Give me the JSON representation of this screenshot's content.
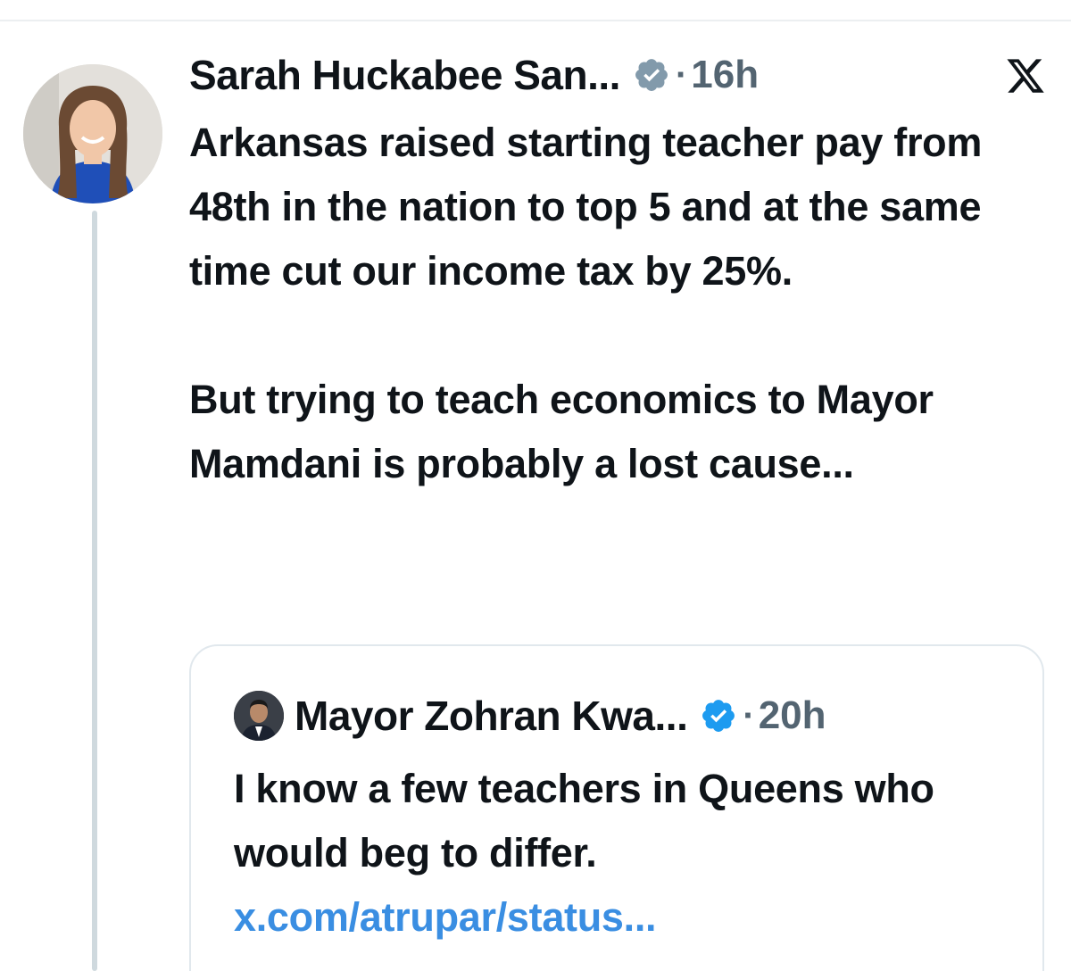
{
  "tweet": {
    "author_name": "Sarah Huckabee San...",
    "separator": "·",
    "time": "16h",
    "paragraphs": [
      "Arkansas raised starting teacher pay from 48th in the nation to top 5 and at the same time cut our income tax by 25%.",
      "But trying to teach economics to Mayor Mamdani is probably a lost cause..."
    ]
  },
  "quote": {
    "author_name": "Mayor Zohran Kwa...",
    "separator": "·",
    "time": "20h",
    "text": "I know a few teachers in Queens who would beg to differ.",
    "link": "x.com/atrupar/status..."
  },
  "colors": {
    "verified_badge": "#829aab",
    "verified_badge_quote": "#1d9bf0",
    "link": "#3a8ee2",
    "thread_line": "#cfd9de",
    "secondary_text": "#536471"
  },
  "icons": {
    "close": "x-logo-icon",
    "verified": "verified-badge-icon"
  }
}
